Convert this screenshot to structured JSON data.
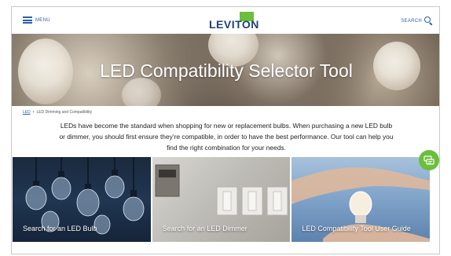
{
  "header": {
    "menu_label": "MENU",
    "logo_text": "LEVITON",
    "search_label": "SEARCH"
  },
  "hero": {
    "title": "LED Compatibility Selector Tool"
  },
  "breadcrumb": {
    "items": [
      "LED",
      "LED Dimming and Compatibility"
    ],
    "separator": "•"
  },
  "intro": {
    "text": "LEDs have become the standard when shopping for new or replacement bulbs. When purchasing a new LED bulb or dimmer, you should first ensure they’re compatible, in order to have the best performance. Our tool can help you find the right combination for your needs."
  },
  "cards": [
    {
      "label": "Search for an LED Bulb"
    },
    {
      "label": "Search for an LED Dimmer"
    },
    {
      "label": "LED Compatibility Tool User Guide"
    }
  ],
  "colors": {
    "brand_blue": "#1f3f7a",
    "link_blue": "#2a5fa8",
    "accent_green": "#6bbf3a"
  },
  "icons": {
    "menu": "hamburger-icon",
    "search": "search-icon",
    "chat": "chat-icon"
  }
}
